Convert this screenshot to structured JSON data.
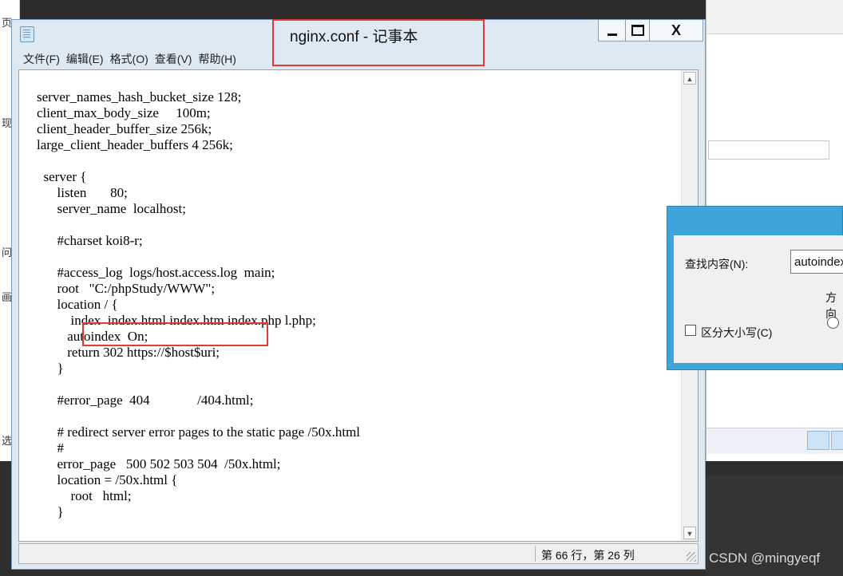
{
  "background": {
    "left_glyphs": [
      "页",
      "现",
      "问",
      "画",
      "选"
    ]
  },
  "notepad": {
    "title": "nginx.conf - 记事本",
    "window_buttons": {
      "minimize": "",
      "maximize": "",
      "close": "X"
    },
    "menu": [
      "文件(F)",
      "编辑(E)",
      "格式(O)",
      "查看(V)",
      "帮助(H)"
    ],
    "code": "server_names_hash_bucket_size 128;\nclient_max_body_size     100m;\nclient_header_buffer_size 256k;\nlarge_client_header_buffers 4 256k;\n\n  server {\n      listen       80;\n      server_name  localhost;\n\n      #charset koi8-r;\n\n      #access_log  logs/host.access.log  main;\n      root   \"C:/phpStudy/WWW\";\n      location / {\n          index  index.html index.htm index.php l.php;\n         autoindex  On;\n         return 302 https://$host$uri;\n      }\n\n      #error_page  404              /404.html;\n\n      # redirect server error pages to the static page /50x.html\n      #\n      error_page   500 502 503 504  /50x.html;\n      location = /50x.html {\n          root   html;\n      }",
    "status": "第 66 行，第 26 列"
  },
  "find_dialog": {
    "label": "查找内容(N):",
    "value": "autoindex",
    "direction_label": "方向",
    "case_label": "区分大小写(C)"
  },
  "watermark": "CSDN @mingyeqf",
  "colors": {
    "highlight": "#e53935",
    "dialog_frame": "#3fa4d9"
  }
}
